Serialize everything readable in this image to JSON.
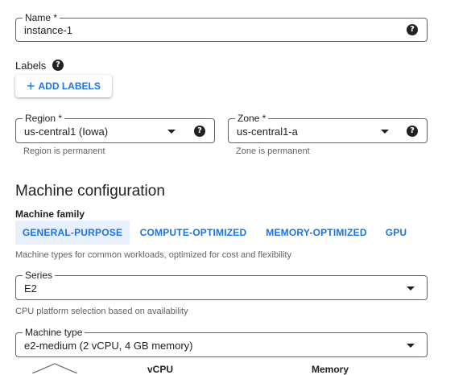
{
  "name_field": {
    "label": "Name *",
    "value": "instance-1"
  },
  "labels": {
    "title": "Labels",
    "add_button": "ADD LABELS",
    "add_icon": "plus-icon"
  },
  "region": {
    "label": "Region *",
    "value": "us-central1 (Iowa)",
    "hint": "Region is permanent"
  },
  "zone": {
    "label": "Zone *",
    "value": "us-central1-a",
    "hint": "Zone is permanent"
  },
  "machine_config": {
    "title": "Machine configuration",
    "family_label": "Machine family",
    "tabs": [
      {
        "label": "GENERAL-PURPOSE",
        "active": true
      },
      {
        "label": "COMPUTE-OPTIMIZED",
        "active": false
      },
      {
        "label": "MEMORY-OPTIMIZED",
        "active": false
      },
      {
        "label": "GPU",
        "active": false
      }
    ],
    "family_description": "Machine types for common workloads, optimized for cost and flexibility",
    "series": {
      "label": "Series",
      "value": "E2",
      "hint": "CPU platform selection based on availability"
    },
    "machine_type": {
      "label": "Machine type",
      "value": "e2-medium (2 vCPU, 4 GB memory)"
    },
    "columns": [
      "vCPU",
      "Memory"
    ]
  },
  "colors": {
    "accent": "#1a73e8",
    "active_tab_bg": "#e8f0fe",
    "text": "#202124",
    "hint": "#5f6368"
  }
}
